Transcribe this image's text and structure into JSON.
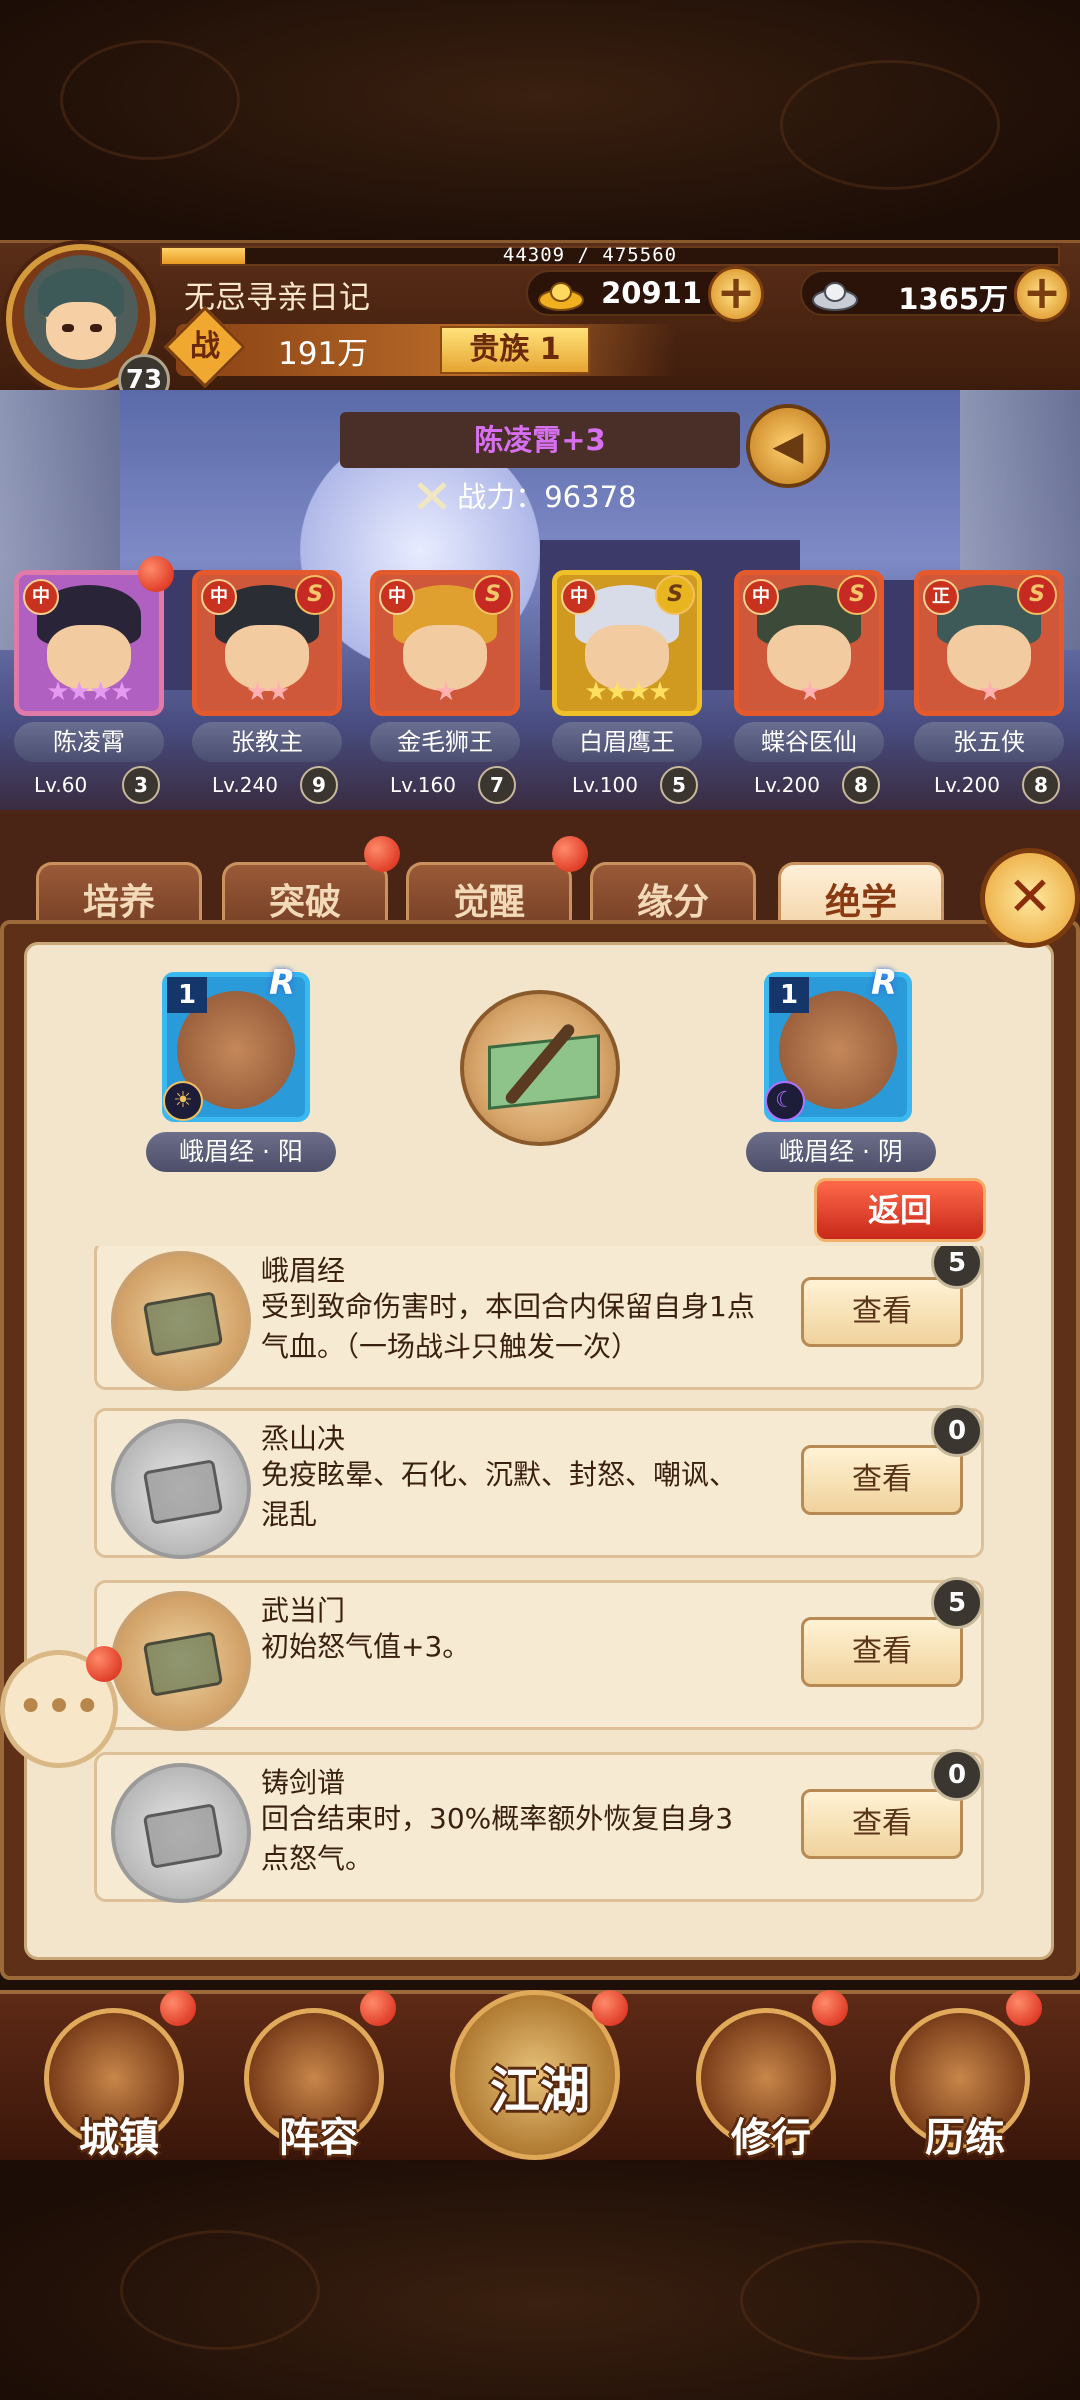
{
  "player": {
    "name": "无忌寻亲日记",
    "level": "73",
    "exp_text": "44309 / 475560",
    "exp_fraction": 0.093,
    "gold": "20911",
    "silver": "1365万",
    "power_icon": "战",
    "power": "191万",
    "noble": "贵族 1"
  },
  "showcase": {
    "hero_name": "陈凌霄+3",
    "power_text": "战力：96378"
  },
  "heroes": [
    {
      "name": "陈凌霄",
      "lv": "Lv.60",
      "count": "3",
      "stars": "★★★★",
      "faction": "中",
      "color": "purple",
      "hair": "#2a2438",
      "badge": ""
    },
    {
      "name": "张教主",
      "lv": "Lv.240",
      "count": "9",
      "stars": "★★",
      "faction": "中",
      "color": "red",
      "hair": "#2a2e34",
      "badge": "S"
    },
    {
      "name": "金毛狮王",
      "lv": "Lv.160",
      "count": "7",
      "stars": "★",
      "faction": "中",
      "color": "red",
      "hair": "#e0a030",
      "badge": "S"
    },
    {
      "name": "白眉鹰王",
      "lv": "Lv.100",
      "count": "5",
      "stars": "★★★★",
      "faction": "中",
      "color": "gold",
      "hair": "#d8dce8",
      "badge": "S"
    },
    {
      "name": "蝶谷医仙",
      "lv": "Lv.200",
      "count": "8",
      "stars": "★",
      "faction": "中",
      "color": "red",
      "hair": "#3c4a3a",
      "badge": "S"
    },
    {
      "name": "张五侠",
      "lv": "Lv.200",
      "count": "8",
      "stars": "★",
      "faction": "正",
      "color": "red",
      "hair": "#3e5a58",
      "badge": "S"
    }
  ],
  "tabs": [
    "培养",
    "突破",
    "觉醒",
    "缘分",
    "绝学"
  ],
  "close_icon": "✕",
  "skills": {
    "yang": {
      "level": "1",
      "label": "峨眉经 · 阳"
    },
    "yin": {
      "level": "1",
      "label": "峨眉经 · 阴"
    },
    "rank_letter": "R",
    "back_label": "返回"
  },
  "techniques": [
    {
      "title": "峨眉经",
      "desc": "受到致命伤害时，本回合内保留自身1点气血。（一场战斗只触发一次）",
      "count": "5",
      "btn": "查看",
      "style": "gold"
    },
    {
      "title": "烝山决",
      "desc": "免疫眩晕、石化、沉默、封怒、嘲讽、混乱",
      "count": "0",
      "btn": "查看",
      "style": "grey"
    },
    {
      "title": "武当门",
      "desc": "初始怒气值+3。",
      "count": "5",
      "btn": "查看",
      "style": "gold"
    },
    {
      "title": "铸剑谱",
      "desc": "回合结束时，30%概率额外恢复自身3点怒气。",
      "count": "0",
      "btn": "查看",
      "style": "grey"
    }
  ],
  "nav": [
    "城镇",
    "阵容",
    "江湖",
    "修行",
    "历练"
  ]
}
